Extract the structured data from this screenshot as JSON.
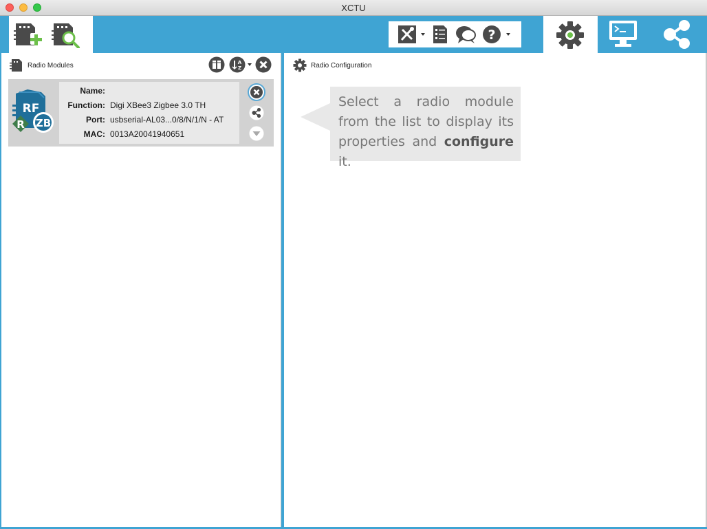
{
  "window": {
    "title": "XCTU"
  },
  "toolbar": {
    "add_device_icon": "add-radio-module-icon",
    "discover_icon": "discover-radio-modules-icon",
    "tools_icon": "tools-icon",
    "frames_icon": "xbee-frames-generator-icon",
    "feedback_icon": "feedback-icon",
    "help_icon": "help-icon",
    "modes": [
      {
        "name": "configuration-mode",
        "icon": "gear-icon",
        "active": true
      },
      {
        "name": "consoles-mode",
        "icon": "console-icon",
        "active": false
      },
      {
        "name": "network-mode",
        "icon": "network-icon",
        "active": false
      }
    ]
  },
  "left_panel": {
    "title": "Radio Modules",
    "module": {
      "icon_text_top": "RF",
      "badge_left": "R",
      "badge_right": "ZB",
      "name_label": "Name:",
      "name_value": "",
      "function_label": "Function:",
      "function_value": "Digi XBee3 Zigbee 3.0 TH",
      "port_label": "Port:",
      "port_value": "usbserial-AL03...0/8/N/1/N - AT",
      "mac_label": "MAC:",
      "mac_value": "0013A20041940651"
    }
  },
  "right_panel": {
    "title": "Radio Configuration",
    "hint_part1": "Select a radio module from the list to display its properties and ",
    "hint_bold": "configure",
    "hint_part2": " it."
  },
  "colors": {
    "accent": "#3fa4d3",
    "icon_dark": "#4a4a4a",
    "green": "#5cb85c"
  }
}
